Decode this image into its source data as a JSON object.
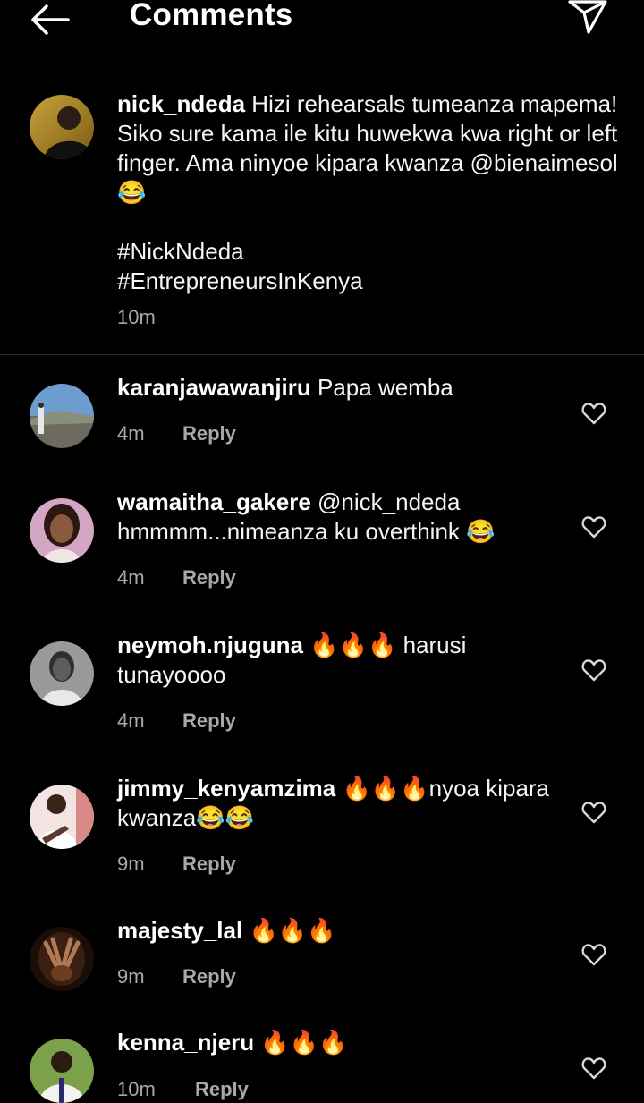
{
  "header": {
    "title": "Comments",
    "back_icon": "arrow-left-icon",
    "share_icon": "paper-plane-icon"
  },
  "caption": {
    "username": "nick_ndeda",
    "text": "Hizi rehearsals tumeanza mapema! Siko sure kama ile kitu huwekwa kwa right or left finger. Ama ninyoe kipara kwanza @bienaimesol 😂",
    "hashtag_1": "#NickNdeda",
    "hashtag_2": "#EntrepreneursInKenya",
    "time": "10m"
  },
  "reply_label": "Reply",
  "comments": [
    {
      "username": "karanjawawanjiru",
      "text": "Papa wemba",
      "time": "4m"
    },
    {
      "username": "wamaitha_gakere",
      "text": "@nick_ndeda hmmmm...nimeanza ku overthink 😂",
      "time": "4m"
    },
    {
      "username": "neymoh.njuguna",
      "text": "🔥🔥🔥 harusi tunayoooo",
      "time": "4m"
    },
    {
      "username": "jimmy_kenyamzima",
      "text": "🔥🔥🔥nyoa kipara kwanza😂😂",
      "time": "9m"
    },
    {
      "username": "majesty_lal",
      "text": "🔥🔥🔥",
      "time": "9m"
    },
    {
      "username": "kenna_njeru",
      "text": "🔥🔥🔥",
      "time": "10m"
    }
  ],
  "icons": {
    "like": "heart-outline-icon"
  },
  "colors": {
    "background": "#000000",
    "text_primary": "#f5f5f5",
    "text_secondary": "#a8a8a8",
    "divider": "#262626"
  }
}
